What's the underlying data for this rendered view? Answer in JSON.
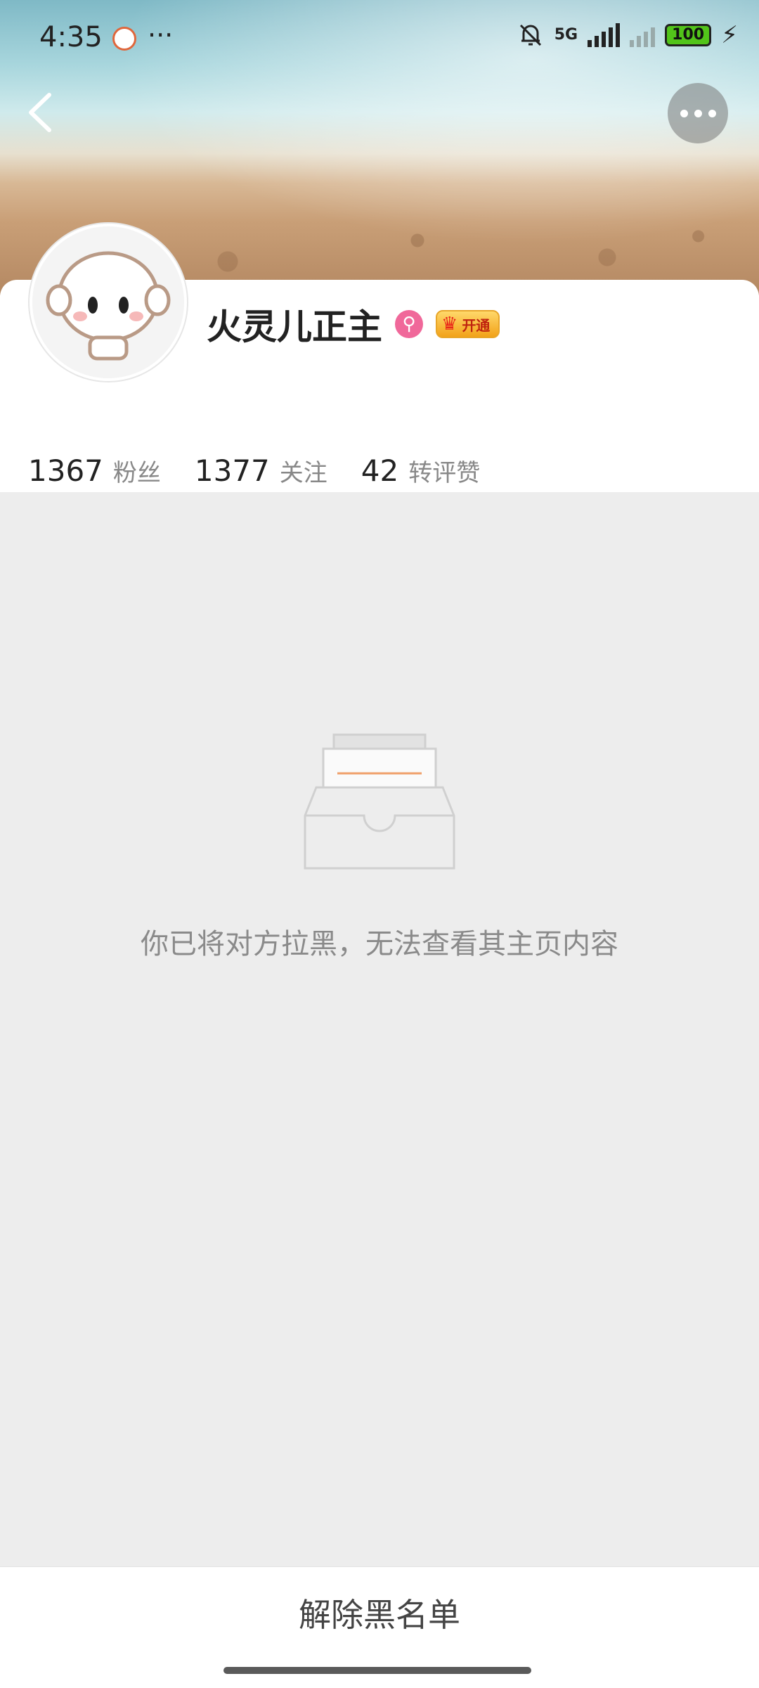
{
  "status_bar": {
    "time": "4:35",
    "dots": "···",
    "network": "5G",
    "battery": "100"
  },
  "profile": {
    "name": "火灵儿正主",
    "gender_icon": "female-search-icon",
    "vip_label": "开通",
    "stats": [
      {
        "value": "1367",
        "label": "粉丝"
      },
      {
        "value": "1377",
        "label": "关注"
      },
      {
        "value": "42",
        "label": "转评赞"
      }
    ]
  },
  "blocked": {
    "message": "你已将对方拉黑，无法查看其主页内容"
  },
  "bottom": {
    "unblock_label": "解除黑名单"
  },
  "colors": {
    "accent_pink": "#f0689a",
    "vip_gold": "#f2a219",
    "background_gray": "#ededed"
  }
}
